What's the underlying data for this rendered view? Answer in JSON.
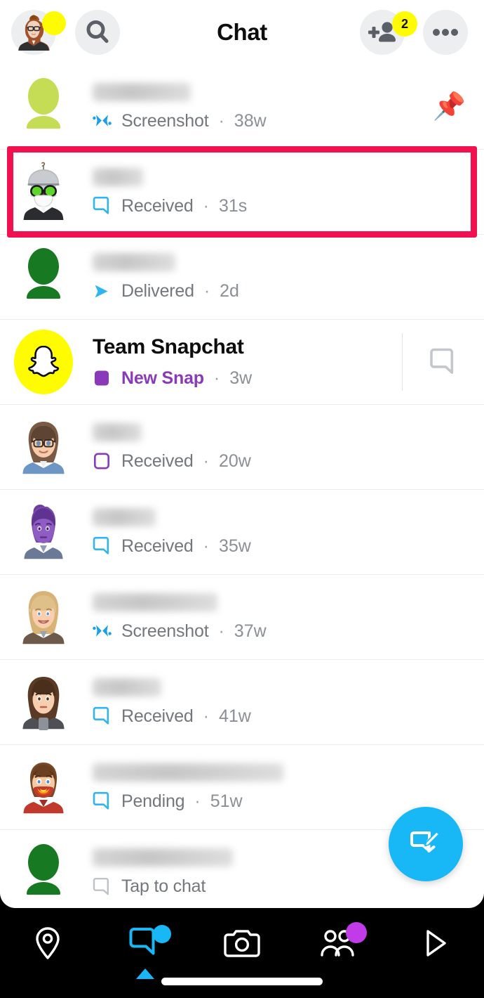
{
  "header": {
    "title": "Chat",
    "avatar_icon": "bitmoji-avatar-icon",
    "avatar_badge": "",
    "search_icon": "search-icon",
    "add_friend_icon": "add-friend-icon",
    "add_friend_badge": "2",
    "more_icon": "more-options-icon"
  },
  "colors": {
    "accent_blue": "#17B8F5",
    "snap_yellow": "#FFFC00",
    "highlight_red": "#F0114E",
    "purple": "#8a3ab9",
    "status_gray": "#73787d"
  },
  "chats": [
    {
      "name": "",
      "name_hidden": true,
      "name_width": 140,
      "avatar": "blank-avatar-lime",
      "status_icon": "screenshot-icon",
      "status": "Screenshot",
      "separator": "·",
      "time": "38w",
      "right_icon": "pin-icon",
      "highlighted": false
    },
    {
      "name": "",
      "name_hidden": true,
      "name_width": 72,
      "avatar": "bitmoji-helmet-mask",
      "status_icon": "chat-bubble-blue-icon",
      "status": "Received",
      "separator": "·",
      "time": "31s",
      "right_icon": "",
      "highlighted": true
    },
    {
      "name": "",
      "name_hidden": true,
      "name_width": 118,
      "avatar": "blank-avatar-green",
      "status_icon": "delivered-arrow-icon",
      "status": "Delivered",
      "separator": "·",
      "time": "2d",
      "right_icon": "",
      "highlighted": false
    },
    {
      "name": "Team Snapchat",
      "name_hidden": false,
      "name_width": 0,
      "avatar": "snapchat-ghost-icon",
      "status_icon": "snap-square-purple-icon",
      "status": "New Snap",
      "separator": "·",
      "time": "3w",
      "right_icon": "chat-bubble-gray-icon",
      "highlighted": false
    },
    {
      "name": "",
      "name_hidden": true,
      "name_width": 70,
      "avatar": "bitmoji-glasses-brunette",
      "status_icon": "snap-square-purple-outline-icon",
      "status": "Received",
      "separator": "·",
      "time": "20w",
      "right_icon": "",
      "highlighted": false
    },
    {
      "name": "",
      "name_hidden": true,
      "name_width": 90,
      "avatar": "bitmoji-purple-hair",
      "status_icon": "chat-bubble-blue-icon",
      "status": "Received",
      "separator": "·",
      "time": "35w",
      "right_icon": "",
      "highlighted": false
    },
    {
      "name": "",
      "name_hidden": true,
      "name_width": 178,
      "avatar": "bitmoji-blonde",
      "status_icon": "screenshot-icon",
      "status": "Screenshot",
      "separator": "·",
      "time": "37w",
      "right_icon": "",
      "highlighted": false
    },
    {
      "name": "",
      "name_hidden": true,
      "name_width": 98,
      "avatar": "bitmoji-brown-hair",
      "status_icon": "chat-bubble-blue-icon",
      "status": "Received",
      "separator": "·",
      "time": "41w",
      "right_icon": "",
      "highlighted": false
    },
    {
      "name": "",
      "name_hidden": true,
      "name_width": 272,
      "avatar": "bitmoji-flame-mask",
      "status_icon": "chat-bubble-blue-icon",
      "status": "Pending",
      "separator": "·",
      "time": "51w",
      "right_icon": "",
      "highlighted": false
    },
    {
      "name": "",
      "name_hidden": true,
      "name_width": 200,
      "avatar": "blank-avatar-green",
      "status_icon": "chat-bubble-gray-icon",
      "status": "Tap to chat",
      "separator": "",
      "time": "",
      "right_icon": "",
      "highlighted": false
    }
  ],
  "fab": {
    "icon": "compose-chat-icon",
    "label": ""
  },
  "navbar": {
    "items": [
      {
        "icon": "map-pin-icon",
        "label": "",
        "active": false,
        "badge": ""
      },
      {
        "icon": "chat-icon",
        "label": "",
        "active": true,
        "badge": "blue-dot"
      },
      {
        "icon": "camera-icon",
        "label": "",
        "active": false,
        "badge": ""
      },
      {
        "icon": "friends-icon",
        "label": "",
        "active": false,
        "badge": "purple-dot"
      },
      {
        "icon": "spotlight-play-icon",
        "label": "",
        "active": false,
        "badge": ""
      }
    ]
  }
}
